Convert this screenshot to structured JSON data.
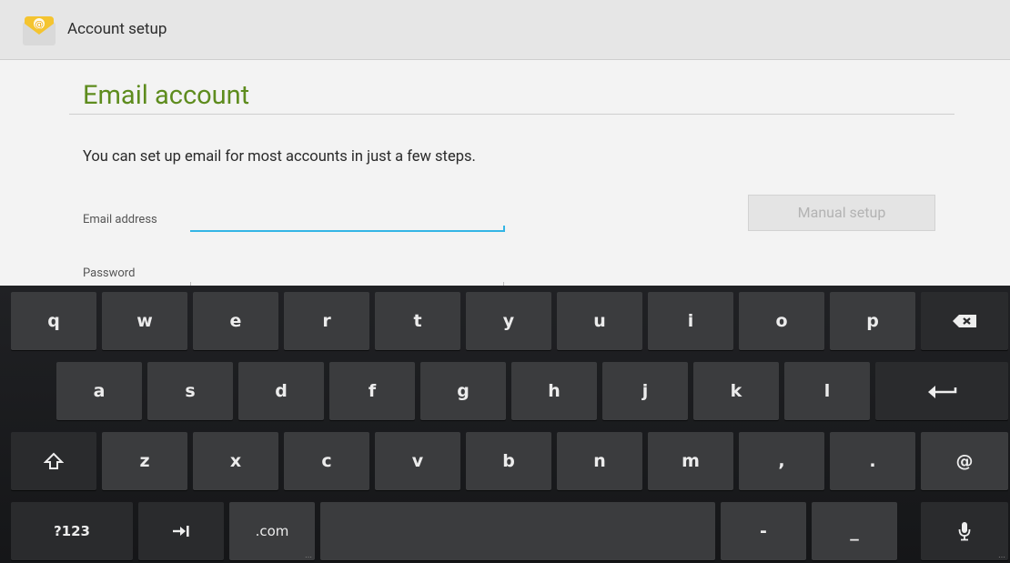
{
  "actionbar": {
    "title": "Account setup",
    "icon": "email-app-icon"
  },
  "page": {
    "title": "Email account",
    "intro": "You can set up email for most accounts in just a few steps.",
    "email_label": "Email address",
    "email_value": "",
    "password_label": "Password",
    "manual_setup_label": "Manual setup"
  },
  "colors": {
    "accent": "#33b5e5",
    "title": "#5e8c1e"
  },
  "keyboard": {
    "row1": [
      "q",
      "w",
      "e",
      "r",
      "t",
      "y",
      "u",
      "i",
      "o",
      "p"
    ],
    "row2": [
      "a",
      "s",
      "d",
      "f",
      "g",
      "h",
      "j",
      "k",
      "l"
    ],
    "row3": [
      "z",
      "x",
      "c",
      "v",
      "b",
      "n",
      "m",
      ",",
      ".",
      "@"
    ],
    "sym_label": "?123",
    "com_label": ".com",
    "dash_label": "-",
    "underscore_label": "_"
  }
}
